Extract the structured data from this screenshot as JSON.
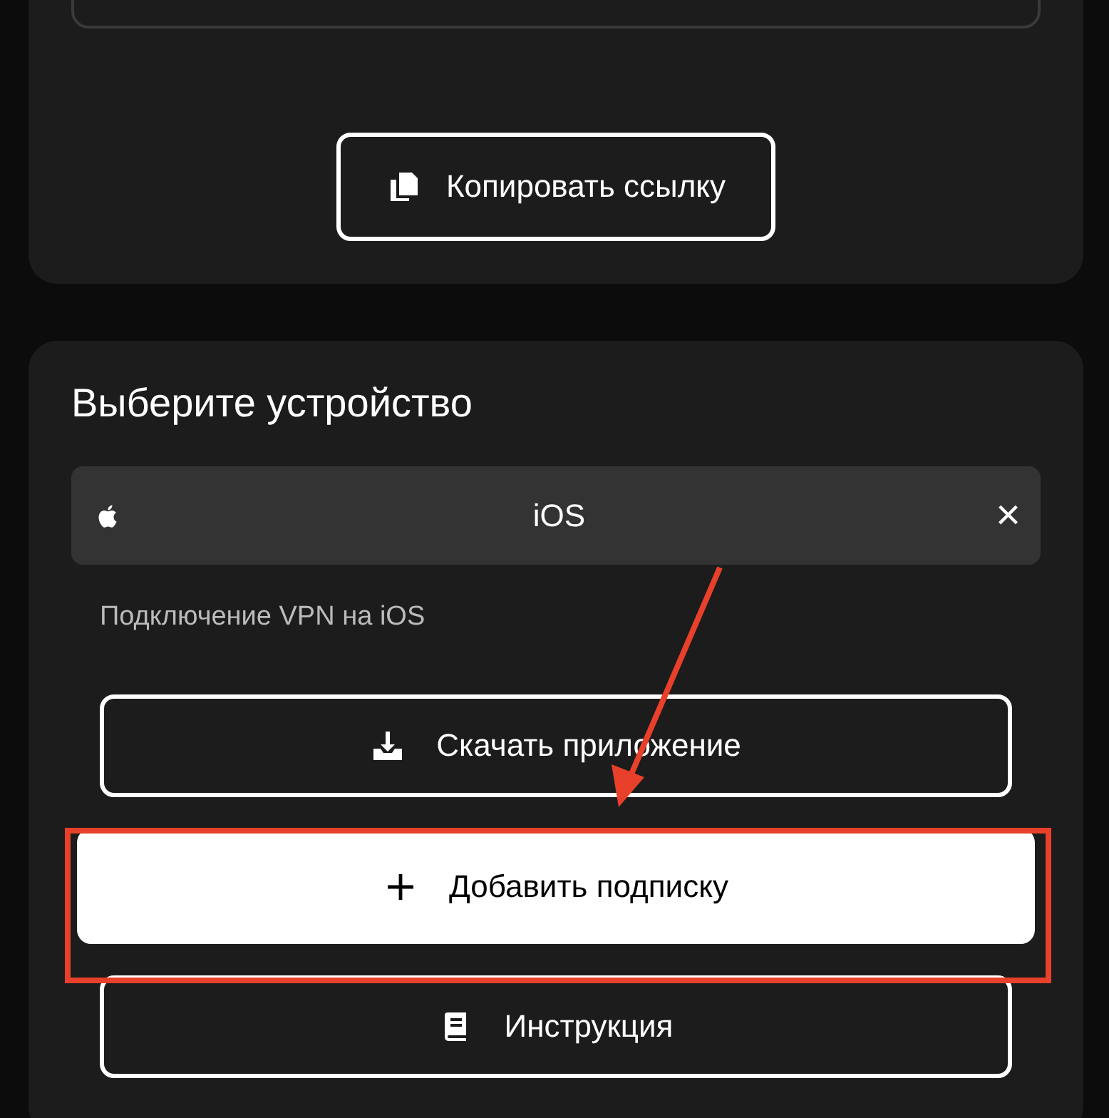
{
  "link_card": {
    "copy_button": "Копировать ссылку"
  },
  "device_card": {
    "title": "Выберите устройство",
    "device_select": {
      "value": "iOS",
      "clear": "×"
    },
    "description": "Подключение VPN на iOS",
    "buttons": [
      {
        "kind": "download",
        "label": "Скачать приложение",
        "primary": false
      },
      {
        "kind": "add",
        "label": "Добавить подписку",
        "primary": true
      },
      {
        "kind": "manual",
        "label": "Инструкция",
        "primary": false
      }
    ]
  }
}
